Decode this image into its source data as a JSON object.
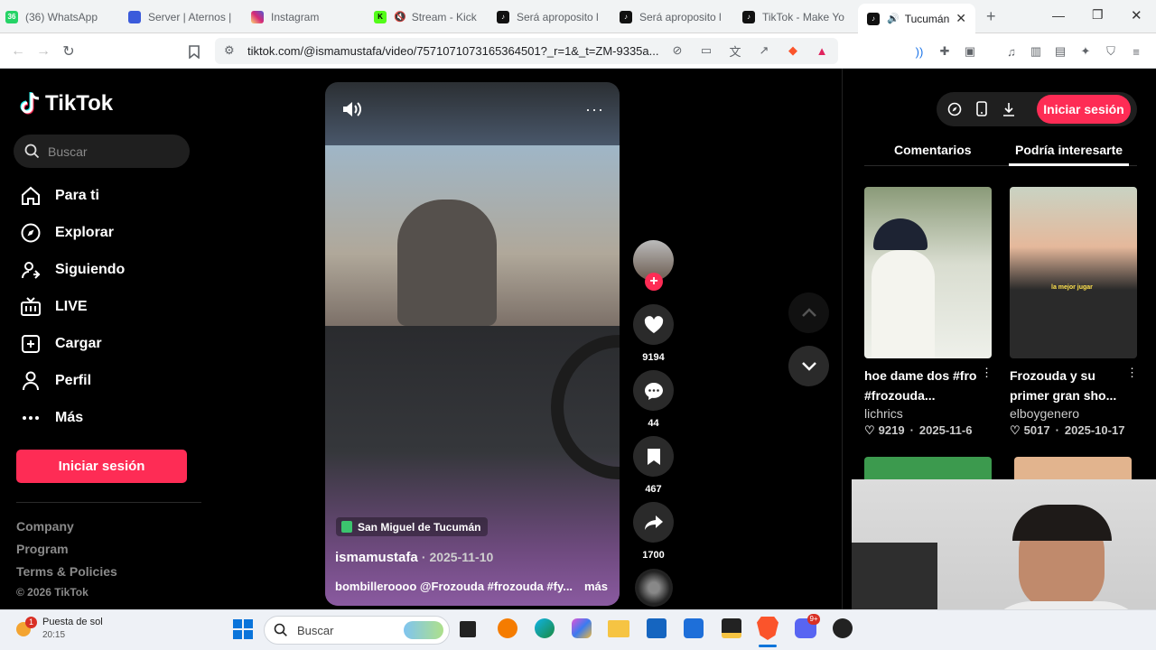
{
  "tabs": [
    {
      "label": "(36) WhatsApp",
      "badge": "36",
      "color": "#25d366"
    },
    {
      "label": "Server | Aternos |",
      "color": "#3b5bdb"
    },
    {
      "label": "Instagram",
      "color": "#d62976"
    },
    {
      "label": "Stream - Kick",
      "color": "#53fc18"
    },
    {
      "label": "Será aproposito l",
      "color": "#111111"
    },
    {
      "label": "Será aproposito l",
      "color": "#111111"
    },
    {
      "label": "TikTok - Make Yo",
      "color": "#111111"
    },
    {
      "label": "Tucumán",
      "color": "#111111"
    }
  ],
  "browser": {
    "url": "tiktok.com/@ismamustafa/video/7571071073165364501?_r=1&_t=ZM-9335a..."
  },
  "sidebar": {
    "logo": "TikTok",
    "search_placeholder": "Buscar",
    "nav": [
      {
        "label": "Para ti",
        "icon": "home-icon"
      },
      {
        "label": "Explorar",
        "icon": "compass-icon"
      },
      {
        "label": "Siguiendo",
        "icon": "following-icon"
      },
      {
        "label": "LIVE",
        "icon": "live-icon"
      },
      {
        "label": "Cargar",
        "icon": "upload-icon"
      },
      {
        "label": "Perfil",
        "icon": "profile-icon"
      },
      {
        "label": "Más",
        "icon": "more-icon"
      }
    ],
    "login": "Iniciar sesión",
    "footer": [
      "Company",
      "Program",
      "Terms & Policies",
      "© 2026 TikTok"
    ]
  },
  "video": {
    "location": "San Miguel de Tucumán",
    "author": "ismamustafa",
    "date": "2025-11-10",
    "caption": "bombilleroooo @Frozouda #frozouda #fy...",
    "more": "más"
  },
  "actions": {
    "likes": "9194",
    "comments": "44",
    "saves": "467",
    "shares": "1700"
  },
  "right": {
    "login": "Iniciar sesión",
    "tab_comments": "Comentarios",
    "tab_interest": "Podría interesarte",
    "cards": [
      {
        "title": "hoe dame dos #fro #frozouda...",
        "author": "lichrics",
        "likes": "9219",
        "date": "2025-11-6"
      },
      {
        "title": "Frozouda y su primer gran sho...",
        "author": "elboygenero",
        "likes": "5017",
        "date": "2025-10-17",
        "overlay": "la mejor jugar"
      }
    ]
  },
  "taskbar": {
    "weather_label": "Puesta de sol",
    "time": "20:15",
    "weather_badge": "1",
    "search_placeholder": "Buscar",
    "discord_badge": "9+"
  }
}
